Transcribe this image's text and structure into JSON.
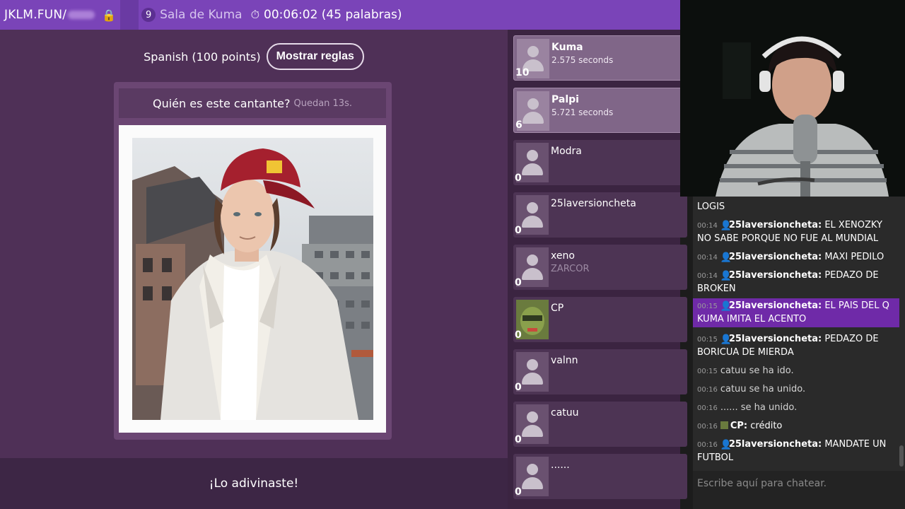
{
  "topbar": {
    "site": "JKLM.FUN/",
    "player_count": "9",
    "room_name": "Sala de Kuma",
    "timer": "00:06:02 (45 palabras)"
  },
  "game": {
    "mode": "Spanish (100 points)",
    "rules_button": "Mostrar reglas",
    "question": "Quién es este cantante?",
    "time_left": "Quedan 13s.",
    "answer_status": "¡Lo adivinaste!"
  },
  "players": [
    {
      "name": "Kuma",
      "points": "10",
      "sub": "2.575 seconds",
      "highlight": true
    },
    {
      "name": "Palpi",
      "points": "6",
      "sub": "5.721 seconds",
      "highlight": true
    },
    {
      "name": "Modra",
      "points": "0",
      "sub": ""
    },
    {
      "name": "25laversioncheta",
      "points": "0",
      "sub": ""
    },
    {
      "name": "xeno",
      "points": "0",
      "sub": "ZARCOR"
    },
    {
      "name": "CP",
      "points": "0",
      "sub": ""
    },
    {
      "name": "valnn",
      "points": "0",
      "sub": ""
    },
    {
      "name": "catuu",
      "points": "0",
      "sub": ""
    },
    {
      "name": "......",
      "points": "0",
      "sub": ""
    }
  ],
  "chat": {
    "messages": [
      {
        "time": "",
        "user": "",
        "text": "LOGIS"
      },
      {
        "time": "00:14",
        "user": "25laversioncheta:",
        "text": "EL XENOZKY NO SABE PORQUE NO FUE AL MUNDIAL"
      },
      {
        "time": "00:14",
        "user": "25laversioncheta:",
        "text": "MAXI PEDILO"
      },
      {
        "time": "00:14",
        "user": "25laversioncheta:",
        "text": "PEDAZO DE BROKEN"
      },
      {
        "time": "00:15",
        "user": "25laversioncheta:",
        "text": "EL PAIS DEL Q KUMA IMITA EL ACENTO"
      },
      {
        "time": "00:15",
        "user": "25laversioncheta:",
        "text": "PEDAZO DE BORICUA DE MIERDA"
      },
      {
        "time": "00:15",
        "user": "",
        "text": "catuu se ha ido."
      },
      {
        "time": "00:16",
        "user": "",
        "text": "catuu se ha unido."
      },
      {
        "time": "00:16",
        "user": "",
        "text": "...... se ha unido."
      },
      {
        "time": "00:16",
        "user": "CP:",
        "text": "crédito"
      },
      {
        "time": "00:16",
        "user": "25laversioncheta:",
        "text": "MANDATE UN FUTBOL"
      }
    ],
    "input_placeholder": "Escribe aquí para chatear."
  },
  "colors": {
    "topbar": "#7a44b8",
    "game_bg": "#4f3057",
    "chat_highlight": "#6f2aa8"
  }
}
